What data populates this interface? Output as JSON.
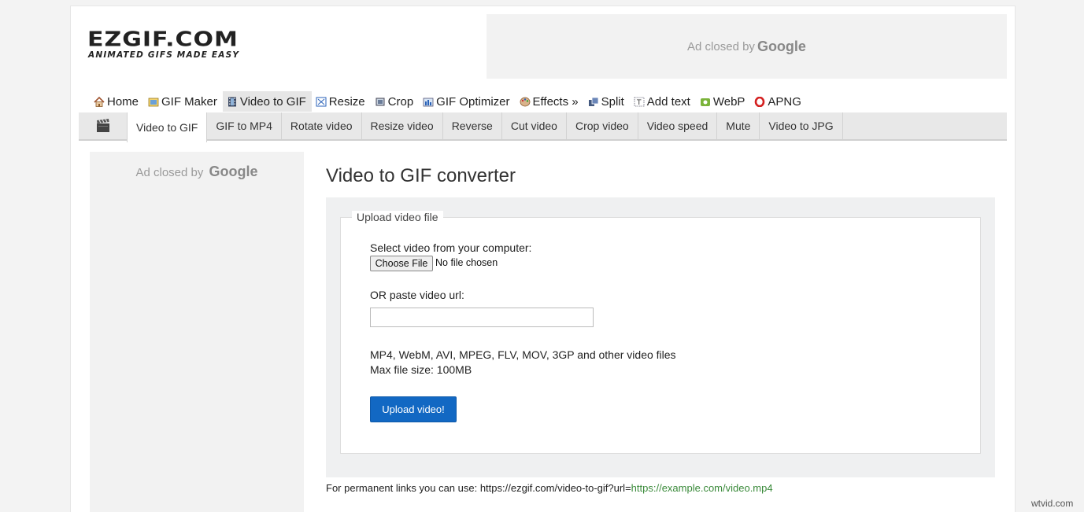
{
  "logo": {
    "main": "EZGIF.COM",
    "tagline": "ANIMATED GIFS MADE EASY"
  },
  "ads": {
    "top": {
      "text": "Ad closed by",
      "brand": "Google"
    },
    "side": {
      "text": "Ad closed by",
      "brand": "Google"
    }
  },
  "main_nav": {
    "items": [
      {
        "label": "Home",
        "icon": "home-icon"
      },
      {
        "label": "GIF Maker",
        "icon": "gif-maker-icon"
      },
      {
        "label": "Video to GIF",
        "icon": "film-icon"
      },
      {
        "label": "Resize",
        "icon": "resize-icon"
      },
      {
        "label": "Crop",
        "icon": "crop-icon"
      },
      {
        "label": "GIF Optimizer",
        "icon": "optimizer-icon"
      },
      {
        "label": "Effects »",
        "icon": "palette-icon"
      },
      {
        "label": "Split",
        "icon": "split-icon"
      },
      {
        "label": "Add text",
        "icon": "add-text-icon"
      },
      {
        "label": "WebP",
        "icon": "webp-icon"
      },
      {
        "label": "APNG",
        "icon": "apng-icon"
      }
    ],
    "active": "Video to GIF"
  },
  "sub_nav": {
    "icon": "clapperboard-icon",
    "tabs": [
      "Video to GIF",
      "GIF to MP4",
      "Rotate video",
      "Resize video",
      "Reverse",
      "Cut video",
      "Crop video",
      "Video speed",
      "Mute",
      "Video to JPG"
    ],
    "active": "Video to GIF"
  },
  "main": {
    "title": "Video to GIF converter",
    "fieldset_legend": "Upload video file",
    "select_label": "Select video from your computer:",
    "choose_file_label": "Choose File",
    "file_status": "No file chosen",
    "url_label": "OR paste video url:",
    "url_value": "",
    "formats_text": "MP4, WebM, AVI, MPEG, FLV, MOV, 3GP and other video files",
    "max_size_text": "Max file size: 100MB",
    "upload_button": "Upload video!"
  },
  "permalink": {
    "prefix": "For permanent links you can use: https://ezgif.com/video-to-gif?url=",
    "example_url": "https://example.com/video.mp4"
  },
  "watermark": "wtvid.com",
  "colors": {
    "upload_button": "#1268c3",
    "permalink_url": "#3a8a3a",
    "active_tab_bg": "#ffffff",
    "subnav_bg": "#e8e8e8"
  }
}
